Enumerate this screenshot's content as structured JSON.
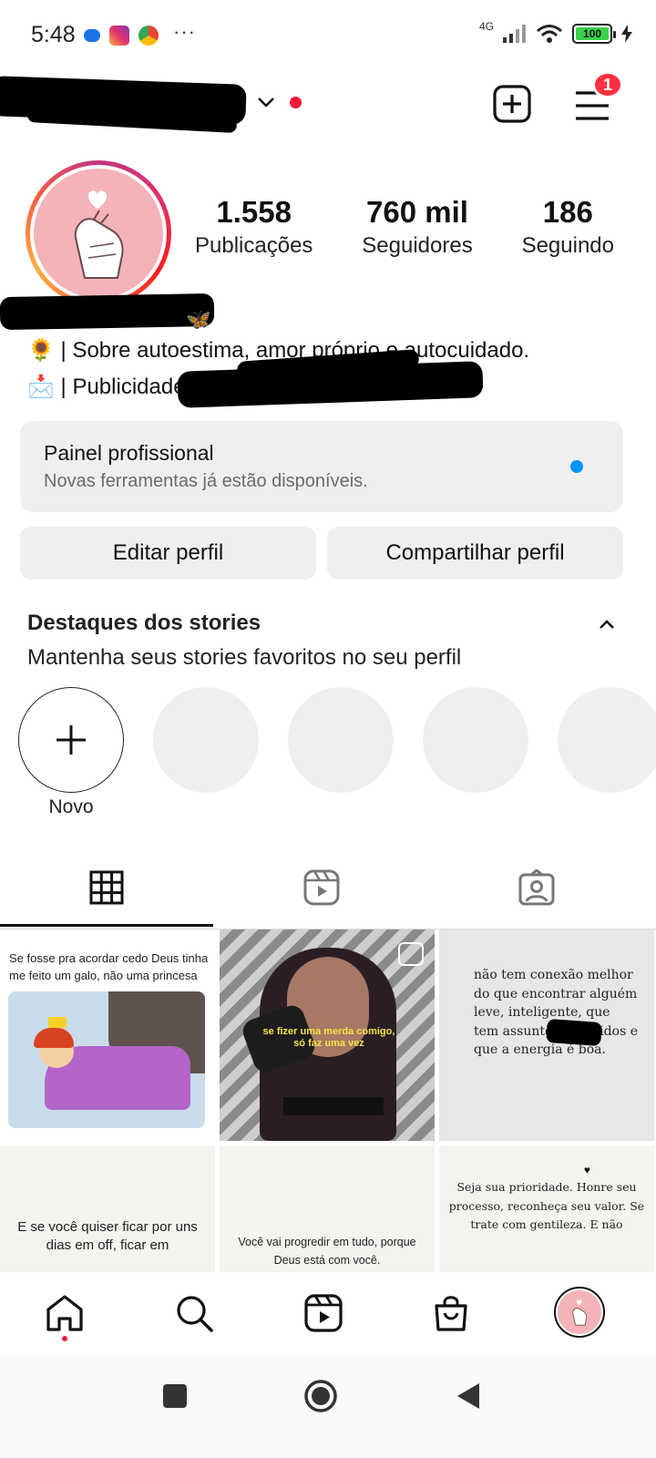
{
  "status_bar": {
    "time": "5:48",
    "more": "···",
    "network": "4G",
    "battery": "100"
  },
  "header": {
    "badge_count": "1"
  },
  "profile": {
    "stats": [
      {
        "value": "1.558",
        "label": "Publicações"
      },
      {
        "value": "760 mil",
        "label": "Seguidores"
      },
      {
        "value": "186",
        "label": "Seguindo"
      }
    ],
    "bio": {
      "emoji_butterfly": "🦋",
      "line1": "🌻 | Sobre autoestima, amor próprio e autocuidado.",
      "line2": "📩 | Publicidade"
    }
  },
  "pro_panel": {
    "title": "Painel profissional",
    "subtitle": "Novas ferramentas já estão disponíveis."
  },
  "buttons": {
    "edit": "Editar perfil",
    "share": "Compartilhar perfil"
  },
  "highlights": {
    "title": "Destaques dos stories",
    "subtitle": "Mantenha seus stories favoritos no seu perfil",
    "new_label": "Novo"
  },
  "posts": {
    "p1_text": "Se fosse pra acordar cedo Deus tinha me feito um galo, não uma princesa",
    "p2_caption": "se fizer uma merda comigo, só faz uma vez",
    "p3_text": "não tem conexão melhor do que encontrar alguém leve, inteligente, que tem assuntos parecidos e que a energia é boa.",
    "p4_text": "E se você quiser ficar por uns dias em off, ficar em",
    "p5_text": "Você vai progredir em tudo, porque Deus está com você.",
    "p6_text": "Seja sua prioridade. Honre seu processo, reconheça seu valor. Se trate com gentileza. E não"
  },
  "colors": {
    "accent_blue": "#0095f6",
    "notification_red": "#ff3040",
    "avatar_pink": "#f4b3b8"
  }
}
